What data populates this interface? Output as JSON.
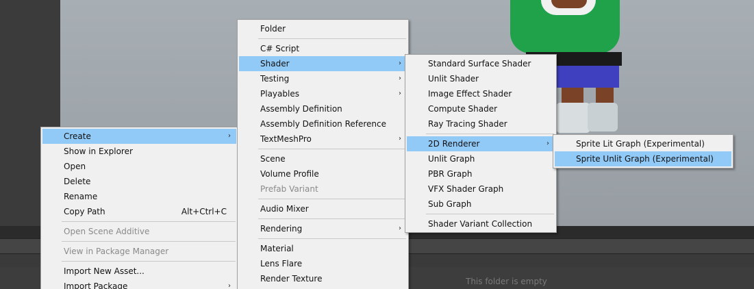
{
  "context_menu": {
    "items": [
      {
        "label": "Create",
        "arrow": "›"
      },
      {
        "label": "Show in Explorer"
      },
      {
        "label": "Open"
      },
      {
        "label": "Delete"
      },
      {
        "label": "Rename"
      },
      {
        "label": "Copy Path",
        "shortcut": "Alt+Ctrl+C"
      },
      {
        "label": "Open Scene Additive"
      },
      {
        "label": "View in Package Manager"
      },
      {
        "label": "Import New Asset..."
      },
      {
        "label": "Import Package",
        "arrow": "›"
      }
    ]
  },
  "create_menu": {
    "items": [
      {
        "label": "Folder"
      },
      {
        "label": "C# Script"
      },
      {
        "label": "Shader",
        "arrow": "›"
      },
      {
        "label": "Testing",
        "arrow": "›"
      },
      {
        "label": "Playables",
        "arrow": "›"
      },
      {
        "label": "Assembly Definition"
      },
      {
        "label": "Assembly Definition Reference"
      },
      {
        "label": "TextMeshPro",
        "arrow": "›"
      },
      {
        "label": "Scene"
      },
      {
        "label": "Volume Profile"
      },
      {
        "label": "Prefab Variant"
      },
      {
        "label": "Audio Mixer"
      },
      {
        "label": "Rendering",
        "arrow": "›"
      },
      {
        "label": "Material"
      },
      {
        "label": "Lens Flare"
      },
      {
        "label": "Render Texture"
      }
    ]
  },
  "shader_menu": {
    "items": [
      {
        "label": "Standard Surface Shader"
      },
      {
        "label": "Unlit Shader"
      },
      {
        "label": "Image Effect Shader"
      },
      {
        "label": "Compute Shader"
      },
      {
        "label": "Ray Tracing Shader"
      },
      {
        "label": "2D Renderer",
        "arrow": "›"
      },
      {
        "label": "Unlit Graph"
      },
      {
        "label": "PBR Graph"
      },
      {
        "label": "VFX Shader Graph"
      },
      {
        "label": "Sub Graph"
      },
      {
        "label": "Shader Variant Collection"
      }
    ]
  },
  "renderer2d_menu": {
    "items": [
      {
        "label": "Sprite Lit Graph (Experimental)"
      },
      {
        "label": "Sprite Unlit Graph (Experimental)"
      }
    ]
  },
  "project_panel": {
    "empty_message": "This folder is empty"
  },
  "colors": {
    "highlight": "#91c9f7",
    "menu_bg": "#f0f0f0",
    "disabled_text": "#8a8a8a"
  }
}
